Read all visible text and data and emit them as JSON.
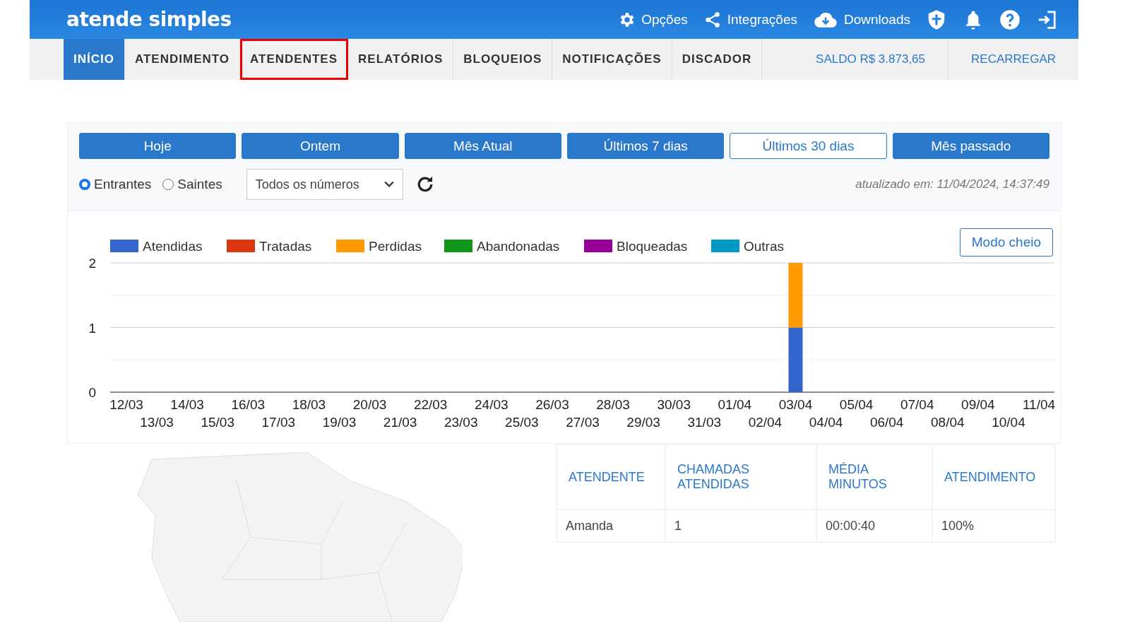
{
  "header": {
    "logo": "atende simples",
    "menu": [
      {
        "label": "Opções",
        "kind": "gear"
      },
      {
        "label": "Integrações",
        "kind": "share"
      },
      {
        "label": "Downloads",
        "kind": "cloud"
      }
    ]
  },
  "nav": {
    "tabs": [
      {
        "label": "INÍCIO",
        "selected": true,
        "highlighted": false
      },
      {
        "label": "ATENDIMENTO",
        "selected": false,
        "highlighted": false
      },
      {
        "label": "ATENDENTES",
        "selected": false,
        "highlighted": true
      },
      {
        "label": "RELATÓRIOS",
        "selected": false,
        "highlighted": false
      },
      {
        "label": "BLOQUEIOS",
        "selected": false,
        "highlighted": false
      },
      {
        "label": "NOTIFICAÇÕES",
        "selected": false,
        "highlighted": false
      },
      {
        "label": "DISCADOR",
        "selected": false,
        "highlighted": false
      }
    ],
    "balance": "SALDO R$ 3.873,65",
    "recharge": "RECARREGAR"
  },
  "periods": [
    {
      "label": "Hoje",
      "selected": false
    },
    {
      "label": "Ontem",
      "selected": false
    },
    {
      "label": "Mês Atual",
      "selected": false
    },
    {
      "label": "Últimos 7 dias",
      "selected": false
    },
    {
      "label": "Últimos 30 dias",
      "selected": true
    },
    {
      "label": "Mês passado",
      "selected": false
    }
  ],
  "direction": [
    {
      "label": "Entrantes",
      "selected": true
    },
    {
      "label": "Saintes",
      "selected": false
    }
  ],
  "number_select": {
    "value": "Todos os números"
  },
  "updated": "atualizado em: 11/04/2024, 14:37:49",
  "chart": {
    "fullscreen_button": "Modo cheio",
    "chart_data": {
      "type": "bar",
      "stacked": true,
      "legend": true,
      "ref_lines": [
        {
          "axis": "y",
          "value": 0.5
        },
        {
          "axis": "y",
          "value": 1.5
        }
      ],
      "categories": [
        "12/03",
        "13/03",
        "14/03",
        "15/03",
        "16/03",
        "17/03",
        "18/03",
        "19/03",
        "20/03",
        "21/03",
        "22/03",
        "23/03",
        "24/03",
        "25/03",
        "26/03",
        "27/03",
        "28/03",
        "29/03",
        "30/03",
        "31/03",
        "01/04",
        "02/04",
        "03/04",
        "04/04",
        "05/04",
        "06/04",
        "07/04",
        "08/04",
        "09/04",
        "10/04",
        "11/04"
      ],
      "ylim": [
        0,
        2
      ],
      "yticks": [
        0,
        1,
        2
      ],
      "series": [
        {
          "name": "Atendidas",
          "color": "#3366cc",
          "values": [
            0,
            0,
            0,
            0,
            0,
            0,
            0,
            0,
            0,
            0,
            0,
            0,
            0,
            0,
            0,
            0,
            0,
            0,
            0,
            0,
            0,
            0,
            1,
            0,
            0,
            0,
            0,
            0,
            0,
            0,
            0
          ]
        },
        {
          "name": "Tratadas",
          "color": "#dc3912",
          "values": [
            0,
            0,
            0,
            0,
            0,
            0,
            0,
            0,
            0,
            0,
            0,
            0,
            0,
            0,
            0,
            0,
            0,
            0,
            0,
            0,
            0,
            0,
            0,
            0,
            0,
            0,
            0,
            0,
            0,
            0,
            0
          ]
        },
        {
          "name": "Perdidas",
          "color": "#ff9900",
          "values": [
            0,
            0,
            0,
            0,
            0,
            0,
            0,
            0,
            0,
            0,
            0,
            0,
            0,
            0,
            0,
            0,
            0,
            0,
            0,
            0,
            0,
            0,
            1,
            0,
            0,
            0,
            0,
            0,
            0,
            0,
            0
          ]
        },
        {
          "name": "Abandonadas",
          "color": "#109618",
          "values": [
            0,
            0,
            0,
            0,
            0,
            0,
            0,
            0,
            0,
            0,
            0,
            0,
            0,
            0,
            0,
            0,
            0,
            0,
            0,
            0,
            0,
            0,
            0,
            0,
            0,
            0,
            0,
            0,
            0,
            0,
            0
          ]
        },
        {
          "name": "Bloqueadas",
          "color": "#990099",
          "values": [
            0,
            0,
            0,
            0,
            0,
            0,
            0,
            0,
            0,
            0,
            0,
            0,
            0,
            0,
            0,
            0,
            0,
            0,
            0,
            0,
            0,
            0,
            0,
            0,
            0,
            0,
            0,
            0,
            0,
            0,
            0
          ]
        },
        {
          "name": "Outras",
          "color": "#0099c6",
          "values": [
            0,
            0,
            0,
            0,
            0,
            0,
            0,
            0,
            0,
            0,
            0,
            0,
            0,
            0,
            0,
            0,
            0,
            0,
            0,
            0,
            0,
            0,
            0,
            0,
            0,
            0,
            0,
            0,
            0,
            0,
            0
          ]
        }
      ]
    }
  },
  "table": {
    "columns": [
      "ATENDENTE",
      "CHAMADAS ATENDIDAS",
      "MÉDIA MINUTOS",
      "ATENDIMENTO"
    ],
    "rows": [
      [
        "Amanda",
        "1",
        "00:00:40",
        "100%"
      ]
    ]
  }
}
